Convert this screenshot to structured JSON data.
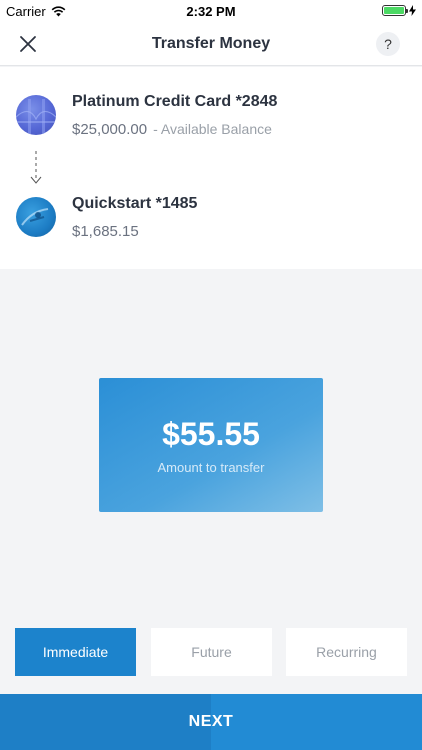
{
  "status_bar": {
    "carrier": "Carrier",
    "time": "2:32 PM"
  },
  "nav": {
    "title": "Transfer Money",
    "help": "?"
  },
  "transfer": {
    "from": {
      "name": "Platinum Credit Card *2848",
      "balance": "$25,000.00",
      "balance_label": "- Available Balance"
    },
    "to": {
      "name": "Quickstart *1485",
      "balance": "$1,685.15"
    }
  },
  "amount": {
    "value": "$55.55",
    "label": "Amount to transfer"
  },
  "options": [
    {
      "label": "Immediate",
      "selected": true
    },
    {
      "label": "Future",
      "selected": false
    },
    {
      "label": "Recurring",
      "selected": false
    }
  ],
  "next_label": "NEXT",
  "colors": {
    "accent": "#1c83cc",
    "battery": "#4cd964"
  }
}
